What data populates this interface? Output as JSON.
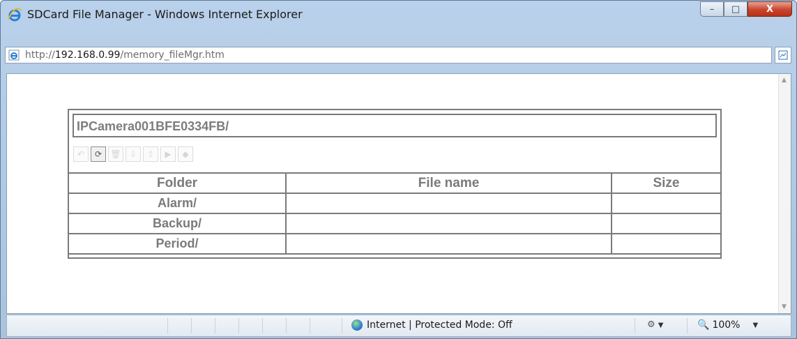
{
  "window": {
    "title": "SDCard File Manager - Windows Internet Explorer",
    "controls": {
      "minimize": "–",
      "maximize": "□",
      "close": "X"
    }
  },
  "address": {
    "prefix": "http://",
    "host": "192.168.0.99",
    "path": "/memory_fileMgr.htm"
  },
  "file_manager": {
    "current_path": "IPCamera001BFE0334FB/",
    "toolbar": [
      {
        "icon": "undo-icon",
        "glyph": "↶",
        "enabled": false
      },
      {
        "icon": "refresh-icon",
        "glyph": "⟳",
        "enabled": true
      },
      {
        "icon": "delete-icon",
        "glyph": "🗑",
        "enabled": false
      },
      {
        "icon": "download-icon",
        "glyph": "⇩",
        "enabled": false
      },
      {
        "icon": "upload-icon",
        "glyph": "⇧",
        "enabled": false
      },
      {
        "icon": "play-icon",
        "glyph": "▶",
        "enabled": false
      },
      {
        "icon": "save-icon",
        "glyph": "◆",
        "enabled": false
      }
    ],
    "columns": {
      "folder": "Folder",
      "file_name": "File name",
      "size": "Size"
    },
    "rows": [
      {
        "folder": "Alarm/",
        "file_name": "",
        "size": ""
      },
      {
        "folder": "Backup/",
        "file_name": "",
        "size": ""
      },
      {
        "folder": "Period/",
        "file_name": "",
        "size": ""
      }
    ]
  },
  "statusbar": {
    "zone": "Internet | Protected Mode: Off",
    "zoom": "100%"
  }
}
